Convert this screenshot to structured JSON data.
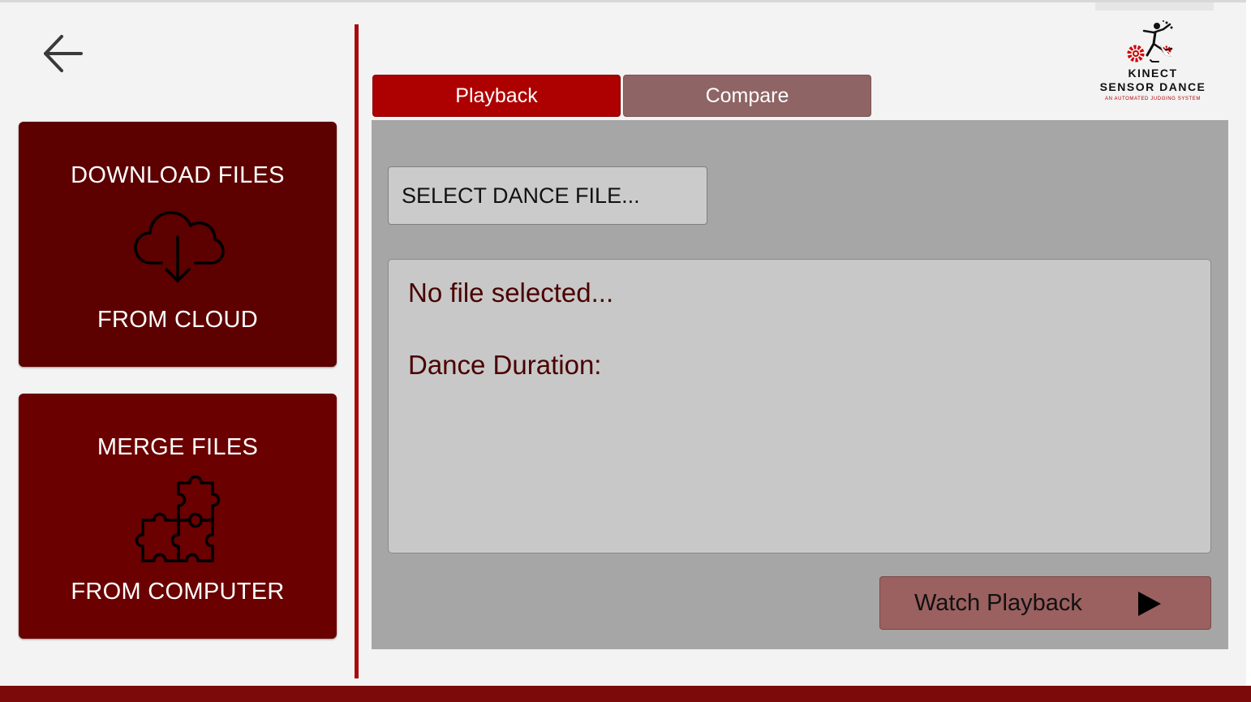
{
  "sidebar": {
    "download_card": {
      "line1": "DOWNLOAD FILES",
      "line2": "FROM CLOUD",
      "icon": "cloud-download-icon"
    },
    "merge_card": {
      "line1": "MERGE FILES",
      "line2": "FROM COMPUTER",
      "icon": "puzzle-pieces-icon"
    },
    "back_icon": "arrow-left-icon"
  },
  "tabs": [
    {
      "label": "Playback",
      "active": true
    },
    {
      "label": "Compare",
      "active": false
    }
  ],
  "logo": {
    "line1": "KINECT",
    "line2": "SENSOR DANCE",
    "tagline": "AN AUTOMATED JUDGING SYSTEM"
  },
  "main": {
    "select_button_label": "SELECT DANCE FILE...",
    "file_status": "No file selected...",
    "duration_label": "Dance Duration:",
    "watch_button_label": "Watch Playback",
    "watch_icon": "play-icon"
  },
  "colors": {
    "accent": "#ad0000",
    "card_dark": "#5c0000",
    "card_merge": "#6a0000",
    "tab_inactive": "#8f6464",
    "panel": "#a6a6a6",
    "info_text": "#4a0000",
    "watch_button": "#9b6060"
  }
}
